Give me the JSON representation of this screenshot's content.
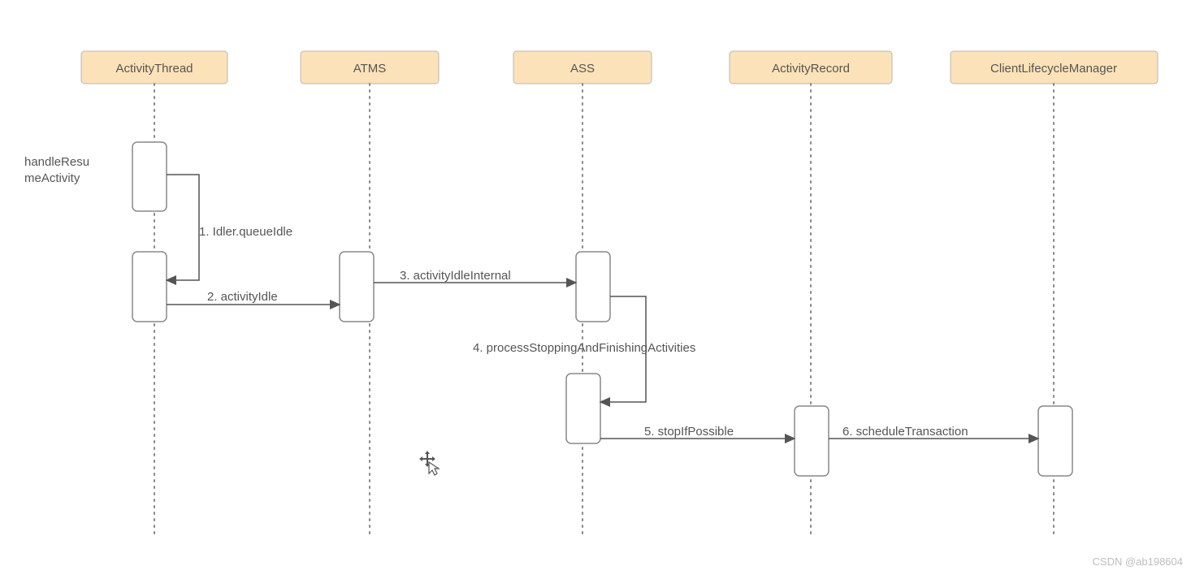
{
  "participants": [
    {
      "id": "p0",
      "label": "ActivityThread"
    },
    {
      "id": "p1",
      "label": "ATMS"
    },
    {
      "id": "p2",
      "label": "ASS"
    },
    {
      "id": "p3",
      "label": "ActivityRecord"
    },
    {
      "id": "p4",
      "label": "ClientLifecycleManager"
    }
  ],
  "side_label": "handleResumeActivity",
  "messages": [
    {
      "id": "m1",
      "label": "1. Idler.queueIdle"
    },
    {
      "id": "m2",
      "label": "2. activityIdle"
    },
    {
      "id": "m3",
      "label": "3. activityIdleInternal"
    },
    {
      "id": "m4",
      "label": "4. processStoppingAndFinishingActivities"
    },
    {
      "id": "m5",
      "label": "5. stopIfPossible"
    },
    {
      "id": "m6",
      "label": "6. scheduleTransaction"
    }
  ],
  "watermark": "CSDN @ab198604",
  "cursor": "move-cursor"
}
